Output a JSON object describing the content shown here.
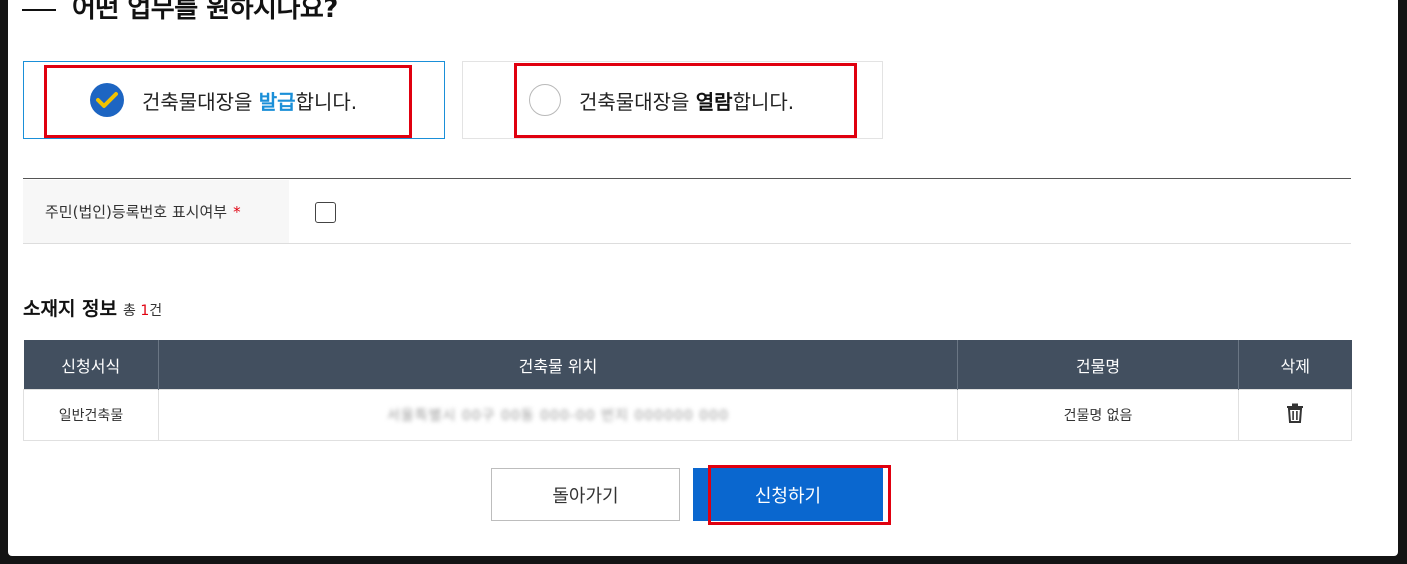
{
  "question_title": "어떤 업무를 원하시나요?",
  "options": {
    "issue": {
      "prefix": "건축물대장을 ",
      "highlight": "발급",
      "suffix": "합니다.",
      "selected": true
    },
    "view": {
      "prefix": "건축물대장을 ",
      "highlight": "열람",
      "suffix": "합니다.",
      "selected": false
    }
  },
  "form": {
    "id_display_label": "주민(법인)등록번호 표시여부",
    "required_mark": "*",
    "checked": false
  },
  "location_section": {
    "title": "소재지 정보",
    "total_prefix": "총 ",
    "count": "1",
    "total_suffix": "건"
  },
  "table": {
    "headers": [
      "신청서식",
      "건축물 위치",
      "건물명",
      "삭제"
    ],
    "rows": [
      {
        "type": "일반건축물",
        "location": "서울특별시 00구 00동 000-00 번지 000000 000",
        "building_name": "건물명 없음",
        "delete_icon": "trash-icon"
      }
    ]
  },
  "buttons": {
    "back": "돌아가기",
    "apply": "신청하기"
  },
  "colors": {
    "accent": "#1a8fd8",
    "primary": "#0a67cf",
    "table_header": "#424f5f",
    "highlight_box": "#e0000f"
  }
}
